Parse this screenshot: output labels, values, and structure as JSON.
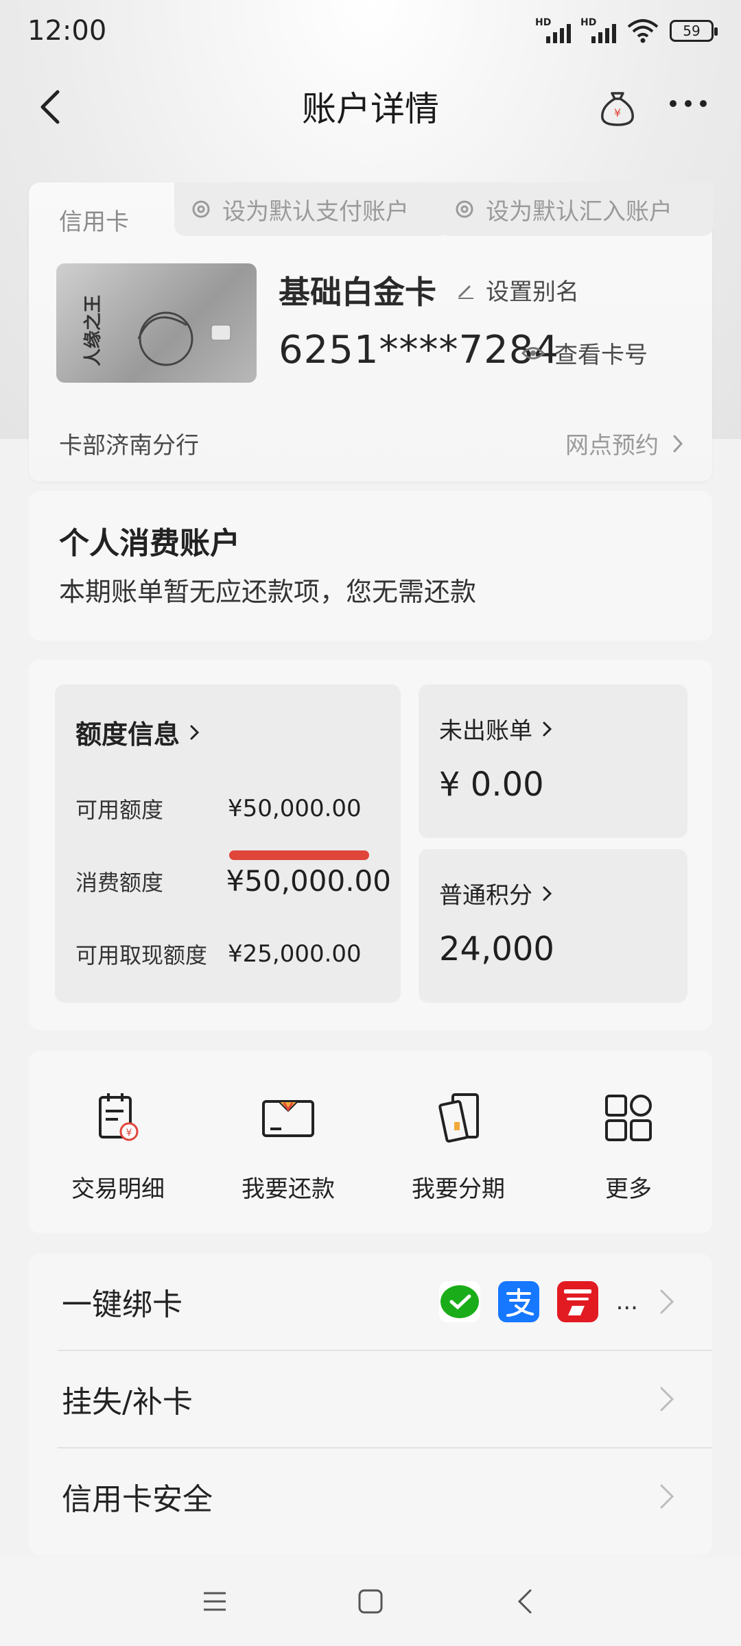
{
  "status_bar": {
    "time": "12:00",
    "battery": "59",
    "signal_label": "HD"
  },
  "nav": {
    "title": "账户详情"
  },
  "card": {
    "tag": "信用卡",
    "set_default_pay": "设为默认支付账户",
    "set_default_receive": "设为默认汇入账户",
    "name": "基础白金卡",
    "alias_label": "设置别名",
    "number": "6251****7284",
    "view_number_label": "查看卡号",
    "branch": "卡部济南分行",
    "outlet_booking": "网点预约",
    "card_image_text": "人缘之王"
  },
  "account": {
    "title": "个人消费账户",
    "description": "本期账单暂无应还款项，您无需还款"
  },
  "limits": {
    "title": "额度信息",
    "available_label": "可用额度",
    "available_value": "¥50,000.00",
    "consumption_label": "消费额度",
    "consumption_value": "¥50,000.00",
    "cash_label": "可用取现额度",
    "cash_value": "¥25,000.00",
    "unbilled_label": "未出账单",
    "unbilled_value": "¥ 0.00",
    "points_label": "普通积分",
    "points_value": "24,000"
  },
  "actions": [
    {
      "label": "交易明细",
      "icon": "transaction-detail-icon"
    },
    {
      "label": "我要还款",
      "icon": "repay-icon"
    },
    {
      "label": "我要分期",
      "icon": "installment-icon"
    },
    {
      "label": "更多",
      "icon": "more-grid-icon"
    }
  ],
  "menu": {
    "bind_card": "一键绑卡",
    "bind_more": "...",
    "report_loss": "挂失/补卡",
    "card_security": "信用卡安全"
  },
  "colors": {
    "accent_red": "#e0453a",
    "wechat_green": "#1aad19",
    "alipay_blue": "#1677ff",
    "unionpay_red": "#e21b23"
  }
}
